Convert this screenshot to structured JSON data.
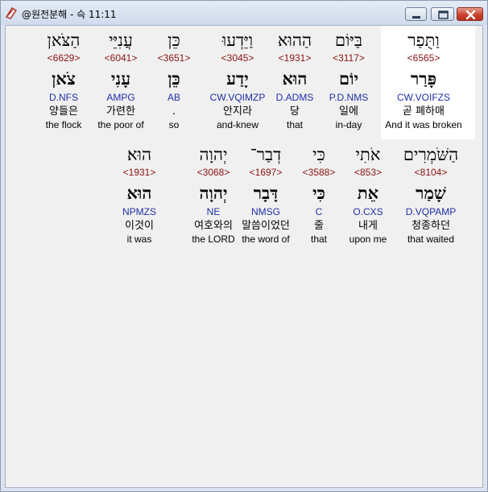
{
  "window": {
    "title": "@원전분해 - 슥 11:11",
    "colors": {
      "strong": "#8b1212",
      "parse": "#1f2fa8",
      "highlight": "#ffffff"
    }
  },
  "row1": [
    {
      "heb": "וַתֻּפַר",
      "strong": "<6565>",
      "lemma": "פָּרַר",
      "parse": "CW.VOIFZS",
      "korean": "곧 폐하매",
      "english": "And it was broken"
    },
    {
      "heb": "בַּיּוֹם",
      "strong": "<3117>",
      "lemma": "יוֹם",
      "parse": "P.D.NMS",
      "korean": "일에",
      "english": "in-day"
    },
    {
      "heb": "הַהוּא",
      "strong": "<1931>",
      "lemma": "הוּא",
      "parse": "D.ADMS",
      "korean": "당",
      "english": "that"
    },
    {
      "heb": "וַיֵּדְעוּ",
      "strong": "<3045>",
      "lemma": "יָדַע",
      "parse": "CW.VQIMZP",
      "korean": "안지라",
      "english": "and-knew"
    },
    {
      "heb": "כֵּן",
      "strong": "<3651>",
      "lemma": "כֵּן",
      "parse": "AB",
      "korean": ".",
      "english": "so"
    },
    {
      "heb": "עֲנִיֵּי",
      "strong": "<6041>",
      "lemma": "עָנִי",
      "parse": "AMPG",
      "korean": "가련한",
      "english": "the poor of"
    },
    {
      "heb": "הַצֹּאן",
      "strong": "<6629>",
      "lemma": "צֹאן",
      "parse": "D.NFS",
      "korean": "양들은",
      "english": "the flock"
    }
  ],
  "row2": [
    {
      "heb": "הַשֹּׁמְרִים",
      "strong": "<8104>",
      "lemma": "שָׁמַר",
      "parse": "D.VQPAMP",
      "korean": "청종하던",
      "english": "that waited"
    },
    {
      "heb": "אֹתִי",
      "strong": "<853>",
      "lemma": "אֵת",
      "parse": "O.CXS",
      "korean": "내게",
      "english": "upon me"
    },
    {
      "heb": "כִּי",
      "strong": "<3588>",
      "lemma": "כִּי",
      "parse": "C",
      "korean": "줄",
      "english": "that"
    },
    {
      "heb": "דְבַר־",
      "strong": "<1697>",
      "lemma": "דָּבָר",
      "parse": "NMSG",
      "korean": "말씀이었던",
      "english": "the word of"
    },
    {
      "heb": "יְהוָה",
      "strong": "<3068>",
      "lemma": "יְהוָה",
      "parse": "NE",
      "korean": "여호와의",
      "english": "the LORD"
    },
    {
      "heb": "הוּא׃",
      "strong": "<1931>",
      "lemma": "הוּא",
      "parse": "NPMZS",
      "korean": "이것이",
      "english": "it was"
    }
  ]
}
